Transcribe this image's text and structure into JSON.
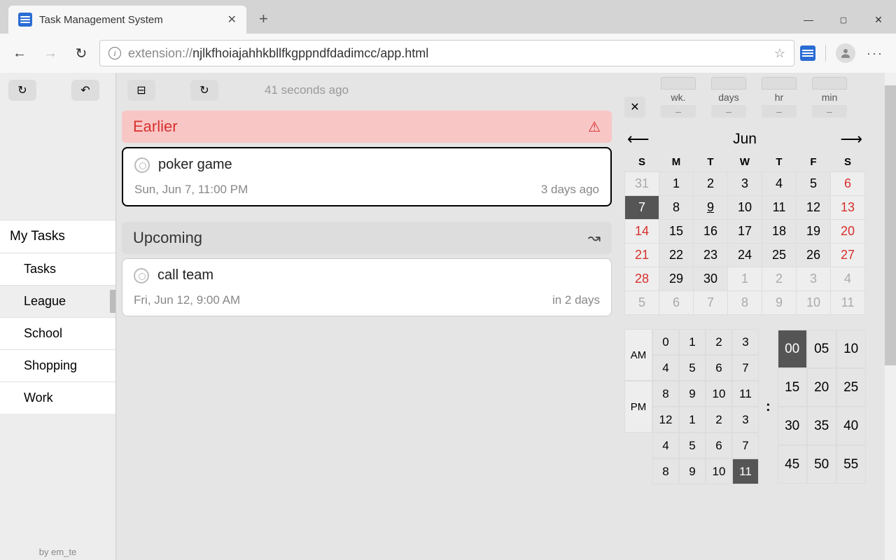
{
  "browser": {
    "tab_title": "Task Management System",
    "url_prefix": "extension://",
    "url_path": "njlkfhoiajahhkbllfkgppndfdadimcc/app.html"
  },
  "sidebar": {
    "header": "My Tasks",
    "items": [
      {
        "label": "Tasks"
      },
      {
        "label": "League"
      },
      {
        "label": "School"
      },
      {
        "label": "Shopping"
      },
      {
        "label": "Work"
      }
    ],
    "footer": "by em_te"
  },
  "main": {
    "status": "41 seconds ago",
    "earlier_label": "Earlier",
    "upcoming_label": "Upcoming",
    "tasks": [
      {
        "title": "poker game",
        "date": "Sun, Jun 7, 11:00 PM",
        "rel": "3 days ago"
      },
      {
        "title": "call team",
        "date": "Fri, Jun 12, 9:00 AM",
        "rel": "in 2 days"
      }
    ]
  },
  "right": {
    "duration": {
      "wk": {
        "label": "wk.",
        "val": "–"
      },
      "days": {
        "label": "days",
        "val": "–"
      },
      "hr": {
        "label": "hr",
        "val": "–"
      },
      "min": {
        "label": "min",
        "val": "–"
      }
    },
    "month": "Jun",
    "dow": [
      "S",
      "M",
      "T",
      "W",
      "T",
      "F",
      "S"
    ],
    "calendar": [
      [
        {
          "d": "31",
          "c": "gray"
        },
        {
          "d": "1"
        },
        {
          "d": "2"
        },
        {
          "d": "3"
        },
        {
          "d": "4"
        },
        {
          "d": "5"
        },
        {
          "d": "6",
          "c": "red"
        }
      ],
      [
        {
          "d": "7",
          "c": "sel"
        },
        {
          "d": "8"
        },
        {
          "d": "9",
          "c": "today"
        },
        {
          "d": "10"
        },
        {
          "d": "11"
        },
        {
          "d": "12"
        },
        {
          "d": "13",
          "c": "red"
        }
      ],
      [
        {
          "d": "14",
          "c": "red"
        },
        {
          "d": "15"
        },
        {
          "d": "16"
        },
        {
          "d": "17"
        },
        {
          "d": "18"
        },
        {
          "d": "19"
        },
        {
          "d": "20",
          "c": "red"
        }
      ],
      [
        {
          "d": "21",
          "c": "red"
        },
        {
          "d": "22"
        },
        {
          "d": "23"
        },
        {
          "d": "24"
        },
        {
          "d": "25"
        },
        {
          "d": "26"
        },
        {
          "d": "27",
          "c": "red"
        }
      ],
      [
        {
          "d": "28",
          "c": "red"
        },
        {
          "d": "29"
        },
        {
          "d": "30"
        },
        {
          "d": "1",
          "c": "gray"
        },
        {
          "d": "2",
          "c": "gray"
        },
        {
          "d": "3",
          "c": "gray"
        },
        {
          "d": "4",
          "c": "gray"
        }
      ],
      [
        {
          "d": "5",
          "c": "gray"
        },
        {
          "d": "6",
          "c": "gray"
        },
        {
          "d": "7",
          "c": "gray"
        },
        {
          "d": "8",
          "c": "gray"
        },
        {
          "d": "9",
          "c": "gray"
        },
        {
          "d": "10",
          "c": "gray"
        },
        {
          "d": "11",
          "c": "gray"
        }
      ]
    ],
    "am_label": "AM",
    "pm_label": "PM",
    "am_hours": [
      "0",
      "1",
      "2",
      "3",
      "4",
      "5",
      "6",
      "7",
      "8",
      "9",
      "10",
      "11"
    ],
    "pm_hours": [
      "12",
      "1",
      "2",
      "3",
      "4",
      "5",
      "6",
      "7",
      "8",
      "9",
      "10",
      "11"
    ],
    "sel_hour_pm_index": 11,
    "minutes": [
      "00",
      "05",
      "10",
      "15",
      "20",
      "25",
      "30",
      "35",
      "40",
      "45",
      "50",
      "55"
    ],
    "sel_min_index": 0
  }
}
